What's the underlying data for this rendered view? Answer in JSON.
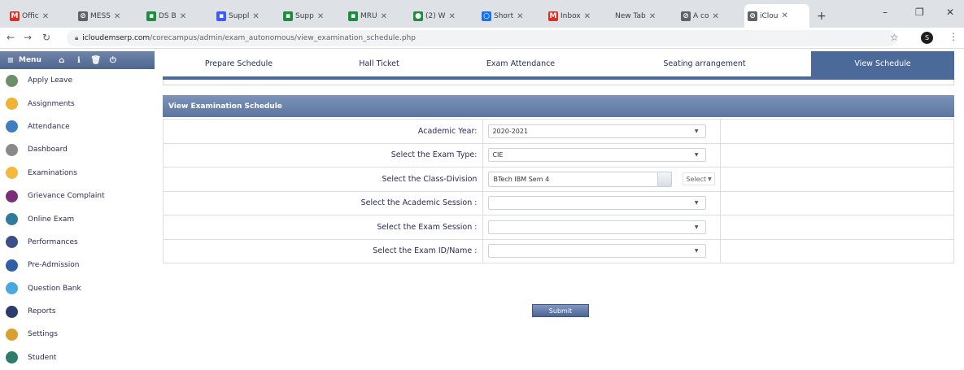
{
  "browser": {
    "tabs": [
      {
        "title": "Offic",
        "favicon": "gmail-icon",
        "color": "#d93025",
        "glyph": "M"
      },
      {
        "title": "MESS",
        "favicon": "globe-icon",
        "color": "#5f6368",
        "glyph": "⊘"
      },
      {
        "title": "DS B",
        "favicon": "classroom-icon",
        "color": "#1e8e3e",
        "glyph": "▪"
      },
      {
        "title": "Suppl",
        "favicon": "doc-icon",
        "color": "#3d5afe",
        "glyph": "▪"
      },
      {
        "title": "Supp",
        "favicon": "classroom-icon",
        "color": "#1e8e3e",
        "glyph": "▪"
      },
      {
        "title": "MRU",
        "favicon": "classroom-icon",
        "color": "#1e8e3e",
        "glyph": "▪"
      },
      {
        "title": "(2) W",
        "favicon": "whatsapp-icon",
        "color": "#1e8e3e",
        "glyph": "●"
      },
      {
        "title": "Short",
        "favicon": "circle-icon",
        "color": "#1a73e8",
        "glyph": "○"
      },
      {
        "title": "Inbox",
        "favicon": "gmail-icon",
        "color": "#d93025",
        "glyph": "M"
      },
      {
        "title": "New Tab",
        "favicon": "",
        "color": "",
        "glyph": ""
      },
      {
        "title": "A co",
        "favicon": "globe-icon",
        "color": "#5f6368",
        "glyph": "⊘"
      },
      {
        "title": "iClou",
        "favicon": "globe-icon",
        "color": "#5f6368",
        "glyph": "⊘"
      }
    ],
    "new_tab_label": "+",
    "url_host": "icloudemserp.com",
    "url_path": "/corecampus/admin/exam_autonomous/view_examination_schedule.php",
    "profile_initial": "S"
  },
  "sidebar": {
    "menu_label": "Menu",
    "items": [
      {
        "label": "Apply Leave",
        "icon": "apply-leave-icon",
        "color": "#6b8e6b"
      },
      {
        "label": "Assignments",
        "icon": "assignments-icon",
        "color": "#f2b233"
      },
      {
        "label": "Attendance",
        "icon": "attendance-icon",
        "color": "#3d7fc1"
      },
      {
        "label": "Dashboard",
        "icon": "dashboard-icon",
        "color": "#8a8a8a"
      },
      {
        "label": "Examinations",
        "icon": "examinations-icon",
        "color": "#f5b83d"
      },
      {
        "label": "Grievance Complaint",
        "icon": "grievance-icon",
        "color": "#7a2f7a"
      },
      {
        "label": "Online Exam",
        "icon": "online-exam-icon",
        "color": "#2f7a9a"
      },
      {
        "label": "Performances",
        "icon": "performances-icon",
        "color": "#3c4f86"
      },
      {
        "label": "Pre-Admission",
        "icon": "pre-admission-icon",
        "color": "#2f5fa5"
      },
      {
        "label": "Question Bank",
        "icon": "question-bank-icon",
        "color": "#49a8dd"
      },
      {
        "label": "Reports",
        "icon": "reports-icon",
        "color": "#2a3d6e"
      },
      {
        "label": "Settings",
        "icon": "settings-icon",
        "color": "#d7a02f"
      },
      {
        "label": "Student",
        "icon": "student-icon",
        "color": "#2e7d6a"
      }
    ]
  },
  "topnav": {
    "tabs": [
      {
        "label": "Prepare Schedule"
      },
      {
        "label": "Hall Ticket"
      },
      {
        "label": "Exam Attendance"
      },
      {
        "label": "Seating arrangement"
      },
      {
        "label": "View Schedule"
      }
    ],
    "active_index": 4
  },
  "panel": {
    "title": "View Examination Schedule",
    "fields": [
      {
        "label": "Academic Year:",
        "value": "2020-2021"
      },
      {
        "label": "Select the Exam Type:",
        "value": "CIE"
      },
      {
        "label": "Select the Class-Division",
        "value": "BTech IBM Sem 4",
        "extra": "Select"
      },
      {
        "label": "Select the Academic Session :",
        "value": ""
      },
      {
        "label": "Select the Exam Session :",
        "value": ""
      },
      {
        "label": "Select the Exam ID/Name :",
        "value": ""
      }
    ],
    "submit_label": "Submit"
  },
  "colors": {
    "accent": "#4c6a99",
    "panel_header": "#6a82ab"
  }
}
